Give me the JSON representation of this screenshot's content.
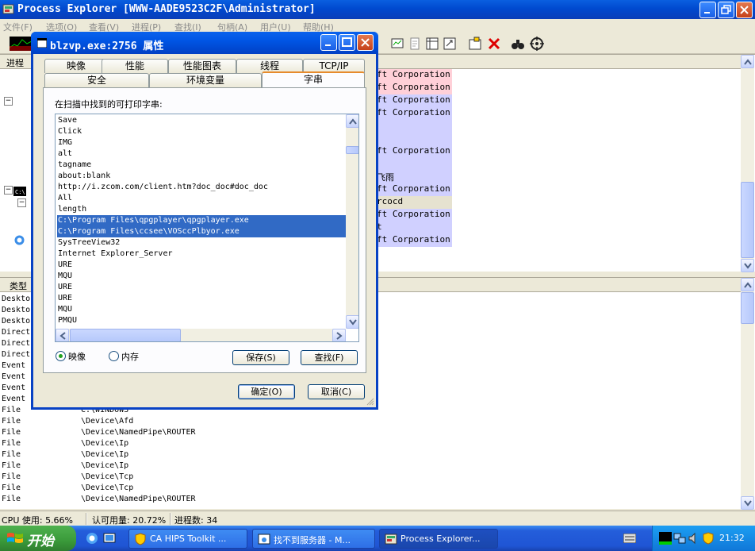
{
  "main_window": {
    "title": "Process Explorer [WWW-AADE9523C2F\\Administrator]",
    "menu": [
      "文件(F)",
      "选项(O)",
      "查看(V)",
      "进程(P)",
      "查找(I)",
      "句柄(A)",
      "用户(U)",
      "帮助(H)"
    ],
    "process_header": "进程",
    "process_rows": [
      {
        "text": "ft Corporation",
        "color": "pink"
      },
      {
        "text": "ft Corporation",
        "color": "pink"
      },
      {
        "text": "ft Corporation",
        "color": "lav"
      },
      {
        "text": "ft Corporation",
        "color": "lav"
      },
      {
        "text": "",
        "color": "lav"
      },
      {
        "text": "",
        "color": "lav"
      },
      {
        "text": "ft Corporation",
        "color": "lav"
      },
      {
        "text": "",
        "color": "lav"
      },
      {
        "text": "飞雨",
        "color": "lav"
      },
      {
        "text": "ft Corporation",
        "color": "lav"
      },
      {
        "text": "rcocd",
        "color": "gray"
      },
      {
        "text": "ft Corporation",
        "color": "lav"
      },
      {
        "text": "t",
        "color": "lav"
      },
      {
        "text": "ft Corporation",
        "color": "lav"
      }
    ],
    "handle_header": "类型",
    "handle_rows": [
      {
        "type": "Deskto",
        "name": ""
      },
      {
        "type": "Deskto",
        "name": ""
      },
      {
        "type": "Deskto",
        "name": ""
      },
      {
        "type": "Direct",
        "name": ""
      },
      {
        "type": "Direct",
        "name": ""
      },
      {
        "type": "Direct",
        "name": ""
      },
      {
        "type": "Event",
        "name": ""
      },
      {
        "type": "Event",
        "name": ""
      },
      {
        "type": "Event",
        "name": ""
      },
      {
        "type": "Event",
        "name": ""
      },
      {
        "type": "File",
        "name": "C:\\WINDOWS"
      },
      {
        "type": "File",
        "name": "\\Device\\Afd"
      },
      {
        "type": "File",
        "name": "\\Device\\NamedPipe\\ROUTER"
      },
      {
        "type": "File",
        "name": "\\Device\\Ip"
      },
      {
        "type": "File",
        "name": "\\Device\\Ip"
      },
      {
        "type": "File",
        "name": "\\Device\\Ip"
      },
      {
        "type": "File",
        "name": "\\Device\\Tcp"
      },
      {
        "type": "File",
        "name": "\\Device\\Tcp"
      },
      {
        "type": "File",
        "name": "\\Device\\NamedPipe\\ROUTER"
      }
    ],
    "status": {
      "cpu": "CPU 使用: 5.66%",
      "commit": "认可用量: 20.72%",
      "processes": "进程数: 34"
    }
  },
  "dialog": {
    "title": "blzvp.exe:2756 属性",
    "tabs_row1": [
      "映像",
      "性能",
      "性能图表",
      "线程",
      "TCP/IP"
    ],
    "tabs_row2": [
      "安全",
      "环境变量",
      "字串"
    ],
    "active_tab": "字串",
    "strings_label": "在扫描中找到的可打印字串:",
    "strings": [
      "Save",
      "Click",
      "IMG",
      "alt",
      "tagname",
      "about:blank",
      "http://i.zcom.com/client.htm?doc_doc#doc_doc",
      "All",
      "length",
      "C:\\Program Files\\qpgplayer\\qpgplayer.exe",
      "C:\\Program Files\\ccsee\\VOSccPlbyor.exe",
      "SysTreeView32",
      "Internet Explorer_Server",
      "URE",
      "MQU",
      "URE",
      "URE",
      "MQU",
      "PMQU"
    ],
    "selected_indices": [
      9,
      10
    ],
    "radio_image": "映像",
    "radio_memory": "内存",
    "save_button": "保存(S)",
    "find_button": "查找(F)",
    "ok_button": "确定(O)",
    "cancel_button": "取消(C)"
  },
  "taskbar": {
    "start_label": "开始",
    "buttons": [
      {
        "label": "CA HIPS Toolkit ...",
        "active": false
      },
      {
        "label": "找不到服务器 - M...",
        "active": false
      },
      {
        "label": "Process Explorer...",
        "active": true
      }
    ],
    "clock": "21:32"
  },
  "colors": {
    "xp_blue": "#0055e5",
    "selection": "#316ac5",
    "pink_row": "#ffd0d8",
    "lavender_row": "#d0d0ff",
    "start_green": "#3a9a3a"
  }
}
